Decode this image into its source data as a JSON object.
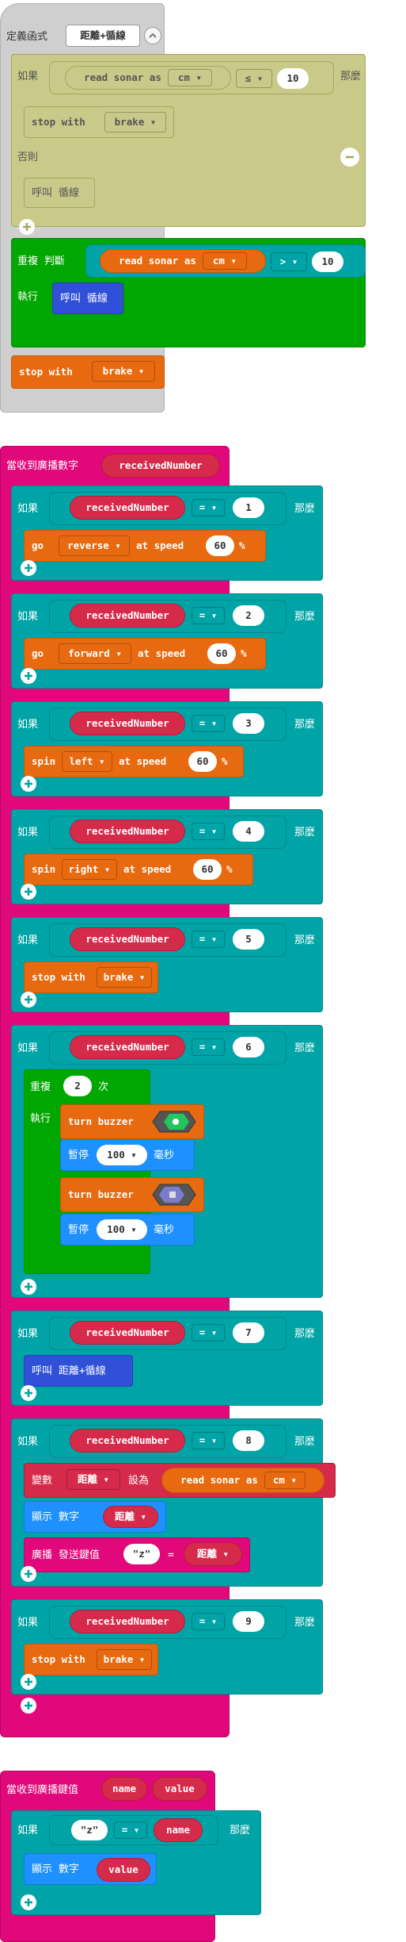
{
  "func": {
    "def_label": "定義函式",
    "name": "距離+循線",
    "if_label": "如果",
    "sonar": "read sonar as",
    "unit": "cm",
    "op": "≤",
    "num": "10",
    "then": "那麼",
    "stop": "stop with",
    "brake": "brake",
    "else": "否則",
    "call": "呼叫 循線",
    "repeat": "重複 判斷",
    "exec": "執行",
    "call2": "呼叫 循線",
    "op2": ">",
    "num2": "10",
    "stop2": "stop with",
    "brake2": "brake"
  },
  "recv": {
    "label": "當收到廣播數字",
    "var": "receivedNumber",
    "if": "如果",
    "then": "那麼",
    "eq": "=",
    "cases": [
      {
        "n": "1",
        "action": "go",
        "opt": "reverse",
        "speed_label": "at speed",
        "speed": "60",
        "pct": "%"
      },
      {
        "n": "2",
        "action": "go",
        "opt": "forward",
        "speed_label": "at speed",
        "speed": "60",
        "pct": "%"
      },
      {
        "n": "3",
        "action": "spin",
        "opt": "left",
        "speed_label": "at speed",
        "speed": "60",
        "pct": "%"
      },
      {
        "n": "4",
        "action": "spin",
        "opt": "right",
        "speed_label": "at speed",
        "speed": "60",
        "pct": "%"
      },
      {
        "n": "5",
        "action": "stop with",
        "opt": "brake"
      },
      {
        "n": "6"
      },
      {
        "n": "7"
      },
      {
        "n": "8"
      },
      {
        "n": "9",
        "action": "stop with",
        "opt": "brake"
      }
    ],
    "repeat": "重複",
    "times_val": "2",
    "times": "次",
    "exec": "執行",
    "buzzer": "turn buzzer",
    "pause": "暫停",
    "ms_val": "100",
    "ms": "毫秒",
    "call": "呼叫 距離+循線",
    "set_var": "變數",
    "dist": "距離",
    "set_to": "設為",
    "sonar": "read sonar as",
    "unit": "cm",
    "show": "顯示 數字",
    "bcast": "廣播 發送鍵值",
    "z": "\"z\"",
    "eqsign": "="
  },
  "recv2": {
    "label": "當收到廣播鍵值",
    "name": "name",
    "value": "value",
    "if": "如果",
    "z": "\"z\"",
    "eq": "=",
    "then": "那麼",
    "show": "顯示 數字"
  },
  "colors": {
    "func_def": "#c8c8c8",
    "if_disabled": "#c9c98a",
    "repeat": "#00a700",
    "motor": "#e86a10",
    "logic": "#00a4a6",
    "event": "#e0087a",
    "var": "#d62a4a",
    "func_call": "#3050d8",
    "basic": "#1e90ff"
  }
}
